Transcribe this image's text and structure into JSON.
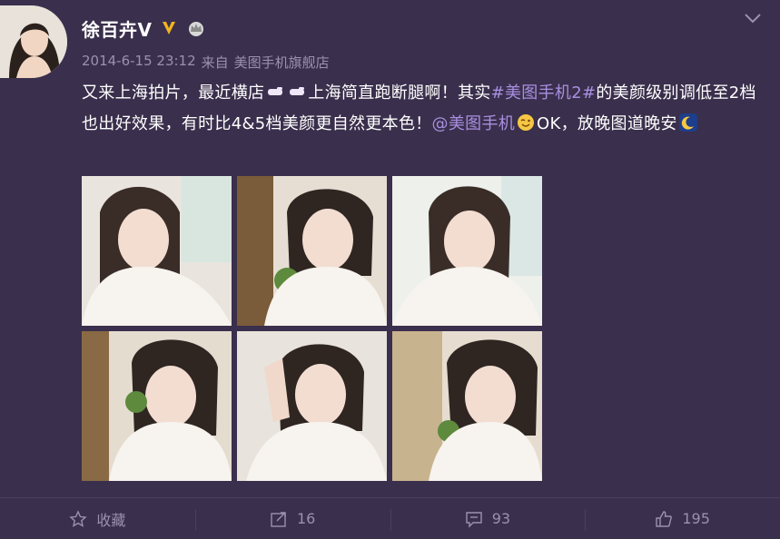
{
  "post": {
    "author": "徐百卉V",
    "badges": [
      "v-badge-icon",
      "crown-icon"
    ],
    "timestamp": "2014-6-15 23:12",
    "source_prefix": "来自",
    "source": "美图手机旗舰店",
    "text": {
      "part1": "又来上海拍片，最近横店",
      "part2": "上海简直跑断腿啊！其实",
      "topic": "#美图手机2#",
      "part3": "的美颜级别调低至2档也出好效果，有时比4&5档美颜更自然更本色！",
      "mention": "@美图手机",
      "part4": "OK，放晚图道晚安"
    },
    "emojis": [
      "pointing-hand-icon",
      "pointing-hand-icon",
      "wink-emoji-icon",
      "moon-emoji-icon"
    ],
    "photos": [
      {
        "label": "selfie-1"
      },
      {
        "label": "selfie-2"
      },
      {
        "label": "selfie-3"
      },
      {
        "label": "selfie-4"
      },
      {
        "label": "selfie-5"
      },
      {
        "label": "selfie-6"
      }
    ]
  },
  "actions": {
    "favorite_label": "收藏",
    "repost_count": "16",
    "comment_count": "93",
    "like_count": "195"
  },
  "colors": {
    "background": "#3a2f4c",
    "link": "#a88fe0",
    "muted": "#9c91ad",
    "divider": "#4a3f5c",
    "badge_gold": "#f2b41f"
  }
}
